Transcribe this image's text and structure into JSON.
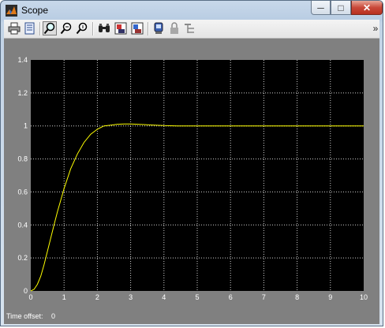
{
  "window": {
    "title": "Scope",
    "minimize_glyph": "─",
    "maximize_glyph": "□",
    "close_glyph": "✕"
  },
  "toolbar": {
    "buttons": [
      {
        "name": "print-icon"
      },
      {
        "name": "parameters-icon"
      },
      {
        "name": "zoom-icon",
        "active": true
      },
      {
        "name": "zoom-x-icon"
      },
      {
        "name": "zoom-y-icon"
      },
      {
        "name": "autoscale-icon"
      },
      {
        "name": "save-axes-settings-icon"
      },
      {
        "name": "restore-axes-settings-icon"
      },
      {
        "name": "floating-scope-icon"
      },
      {
        "name": "lock-axes-icon"
      },
      {
        "name": "signal-selection-icon"
      }
    ],
    "overflow_glyph": "»"
  },
  "status": {
    "time_offset_label": "Time offset:",
    "time_offset_value": "0"
  },
  "chart_data": {
    "type": "line",
    "background": "#000000",
    "line_color": "#ffff00",
    "grid": true,
    "xlim": [
      0,
      10
    ],
    "ylim": [
      0,
      1.4
    ],
    "x_ticks": [
      "0",
      "1",
      "2",
      "3",
      "4",
      "5",
      "6",
      "7",
      "8",
      "9",
      "10"
    ],
    "y_ticks": [
      "0",
      "0.2",
      "0.4",
      "0.6",
      "0.8",
      "1",
      "1.2",
      "1.4"
    ],
    "series": [
      {
        "x": [
          0,
          0.1,
          0.2,
          0.3,
          0.4,
          0.5,
          0.6,
          0.7,
          0.8,
          0.9,
          1.0,
          1.2,
          1.4,
          1.6,
          1.8,
          2.0,
          2.2,
          2.4,
          2.6,
          2.8,
          3.0,
          3.2,
          3.4,
          3.6,
          3.8,
          4.0,
          4.4,
          5.0,
          6.0,
          7.0,
          8.0,
          9.0,
          10.0
        ],
        "y": [
          0,
          0.01,
          0.04,
          0.09,
          0.16,
          0.24,
          0.32,
          0.4,
          0.48,
          0.55,
          0.62,
          0.74,
          0.83,
          0.9,
          0.95,
          0.98,
          1.0,
          1.005,
          1.01,
          1.012,
          1.012,
          1.01,
          1.008,
          1.006,
          1.004,
          1.002,
          1.0,
          1.0,
          1.0,
          1.0,
          1.0,
          1.0,
          1.0
        ]
      }
    ]
  }
}
